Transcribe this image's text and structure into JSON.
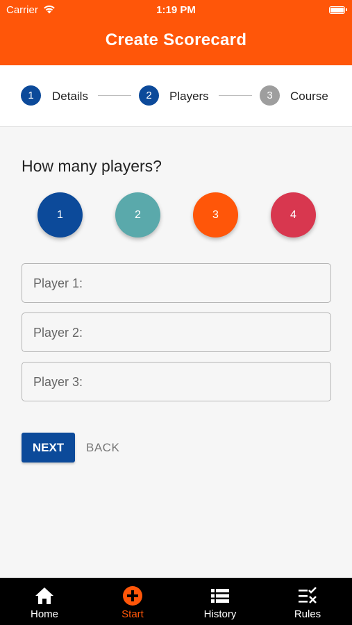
{
  "status_bar": {
    "carrier": "Carrier",
    "time": "1:19 PM"
  },
  "header": {
    "title": "Create Scorecard"
  },
  "stepper": {
    "steps": [
      {
        "number": "1",
        "label": "Details",
        "state": "done",
        "color": "#0c4a9a"
      },
      {
        "number": "2",
        "label": "Players",
        "state": "active",
        "color": "#0c4a9a"
      },
      {
        "number": "3",
        "label": "Course",
        "state": "pending",
        "color": "#9e9e9e"
      }
    ]
  },
  "main": {
    "question": "How many players?",
    "player_count_options": [
      {
        "label": "1",
        "color": "#0c4a9a"
      },
      {
        "label": "2",
        "color": "#5aa9ab"
      },
      {
        "label": "3",
        "color": "#ff5609"
      },
      {
        "label": "4",
        "color": "#d8374f"
      }
    ],
    "player_fields": [
      {
        "placeholder": "Player 1:",
        "value": ""
      },
      {
        "placeholder": "Player 2:",
        "value": ""
      },
      {
        "placeholder": "Player 3:",
        "value": ""
      }
    ],
    "next_label": "NEXT",
    "back_label": "BACK"
  },
  "tabbar": {
    "tabs": [
      {
        "label": "Home",
        "icon": "home-icon",
        "active": false
      },
      {
        "label": "Start",
        "icon": "add-circle-icon",
        "active": true
      },
      {
        "label": "History",
        "icon": "list-icon",
        "active": false
      },
      {
        "label": "Rules",
        "icon": "rules-icon",
        "active": false
      }
    ]
  },
  "colors": {
    "brand_orange": "#ff5609",
    "primary_blue": "#0c4a9a",
    "tab_bar_bg": "#000000"
  }
}
